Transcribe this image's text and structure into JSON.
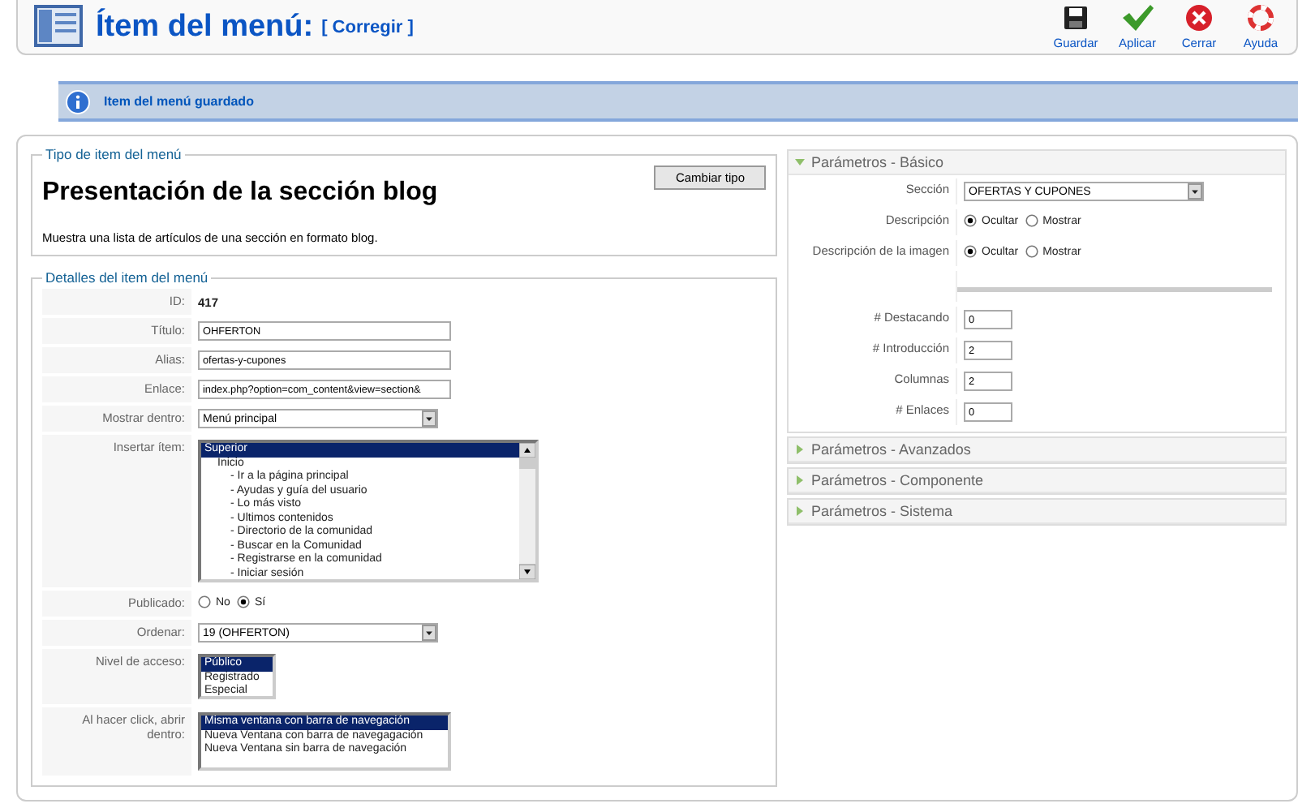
{
  "header": {
    "title": "Ítem del menú:",
    "subtitle": "[ Corregir ]"
  },
  "toolbar": [
    {
      "kind": "save",
      "label": "Guardar"
    },
    {
      "kind": "apply",
      "label": "Aplicar"
    },
    {
      "kind": "close",
      "label": "Cerrar"
    },
    {
      "kind": "help",
      "label": "Ayuda"
    }
  ],
  "message": "Item del menú guardado",
  "type_section": {
    "legend": "Tipo de item del menú",
    "button": "Cambiar tipo",
    "heading": "Presentación de la sección blog",
    "description": "Muestra una lista de artículos de una sección en formato blog."
  },
  "details": {
    "legend": "Detalles del item del menú",
    "rows": [
      {
        "kind": "static",
        "label": "ID:",
        "value": "417"
      },
      {
        "kind": "text",
        "label": "Título:",
        "value": "OHFERTON"
      },
      {
        "kind": "text",
        "label": "Alias:",
        "value": "ofertas-y-cupones"
      },
      {
        "kind": "text",
        "label": "Enlace:",
        "value": "index.php?option=com_content&view=section&"
      },
      {
        "kind": "select",
        "label": "Mostrar dentro:",
        "value": "Menú principal"
      },
      {
        "kind": "tree",
        "label": "Insertar ítem:",
        "items": [
          {
            "label": "Superior",
            "selected": true,
            "children": [
              {
                "label": "Inicio",
                "selected": false,
                "children": [
                  {
                    "label": "- Ir a la página principal",
                    "selected": false
                  },
                  {
                    "label": "- Ayudas y guía del usuario",
                    "selected": false
                  },
                  {
                    "label": "- Lo más visto",
                    "selected": false
                  },
                  {
                    "label": "- Ultimos contenidos",
                    "selected": false
                  },
                  {
                    "label": "- Directorio de la comunidad",
                    "selected": false
                  },
                  {
                    "label": "- Buscar en la Comunidad",
                    "selected": false
                  },
                  {
                    "label": "- Registrarse en la comunidad",
                    "selected": false
                  },
                  {
                    "label": "- Iniciar sesión",
                    "selected": false
                  }
                ]
              }
            ]
          }
        ]
      },
      {
        "kind": "radio",
        "label": "Publicado:",
        "options": [
          {
            "label": "No",
            "selected": false
          },
          {
            "label": "Sí",
            "selected": true
          }
        ]
      },
      {
        "kind": "select",
        "label": "Ordenar:",
        "value": "19 (OHFERTON)"
      },
      {
        "kind": "list",
        "label": "Nivel de acceso:",
        "items": [
          {
            "label": "Público",
            "selected": true
          },
          {
            "label": "Registrado",
            "selected": false
          },
          {
            "label": "Especial",
            "selected": false
          }
        ]
      },
      {
        "kind": "list",
        "label": "Al hacer click, abrir dentro:",
        "items": [
          {
            "label": "Misma ventana con barra de navegación",
            "selected": true
          },
          {
            "label": "Nueva Ventana con barra de navegagación",
            "selected": false
          },
          {
            "label": "Nueva Ventana sin barra de navegación",
            "selected": false
          }
        ]
      }
    ]
  },
  "panels": [
    {
      "title": "Parámetros - Básico",
      "expanded": true,
      "rows": [
        {
          "kind": "select",
          "label": "Sección",
          "value": "OFERTAS Y CUPONES"
        },
        {
          "kind": "radio",
          "label": "Descripción",
          "options": [
            {
              "label": "Ocultar",
              "selected": true
            },
            {
              "label": "Mostrar",
              "selected": false
            }
          ]
        },
        {
          "kind": "radio",
          "label": "Descripción de la imagen",
          "options": [
            {
              "label": "Ocultar",
              "selected": true
            },
            {
              "label": "Mostrar",
              "selected": false
            }
          ]
        },
        {
          "kind": "separator"
        },
        {
          "kind": "text",
          "label": "# Destacando",
          "value": "0"
        },
        {
          "kind": "text",
          "label": "# Introducción",
          "value": "2"
        },
        {
          "kind": "text",
          "label": "Columnas",
          "value": "2"
        },
        {
          "kind": "text",
          "label": "# Enlaces",
          "value": "0"
        }
      ]
    },
    {
      "title": "Parámetros - Avanzados",
      "expanded": false
    },
    {
      "title": "Parámetros - Componente",
      "expanded": false
    },
    {
      "title": "Parámetros - Sistema",
      "expanded": false
    }
  ]
}
